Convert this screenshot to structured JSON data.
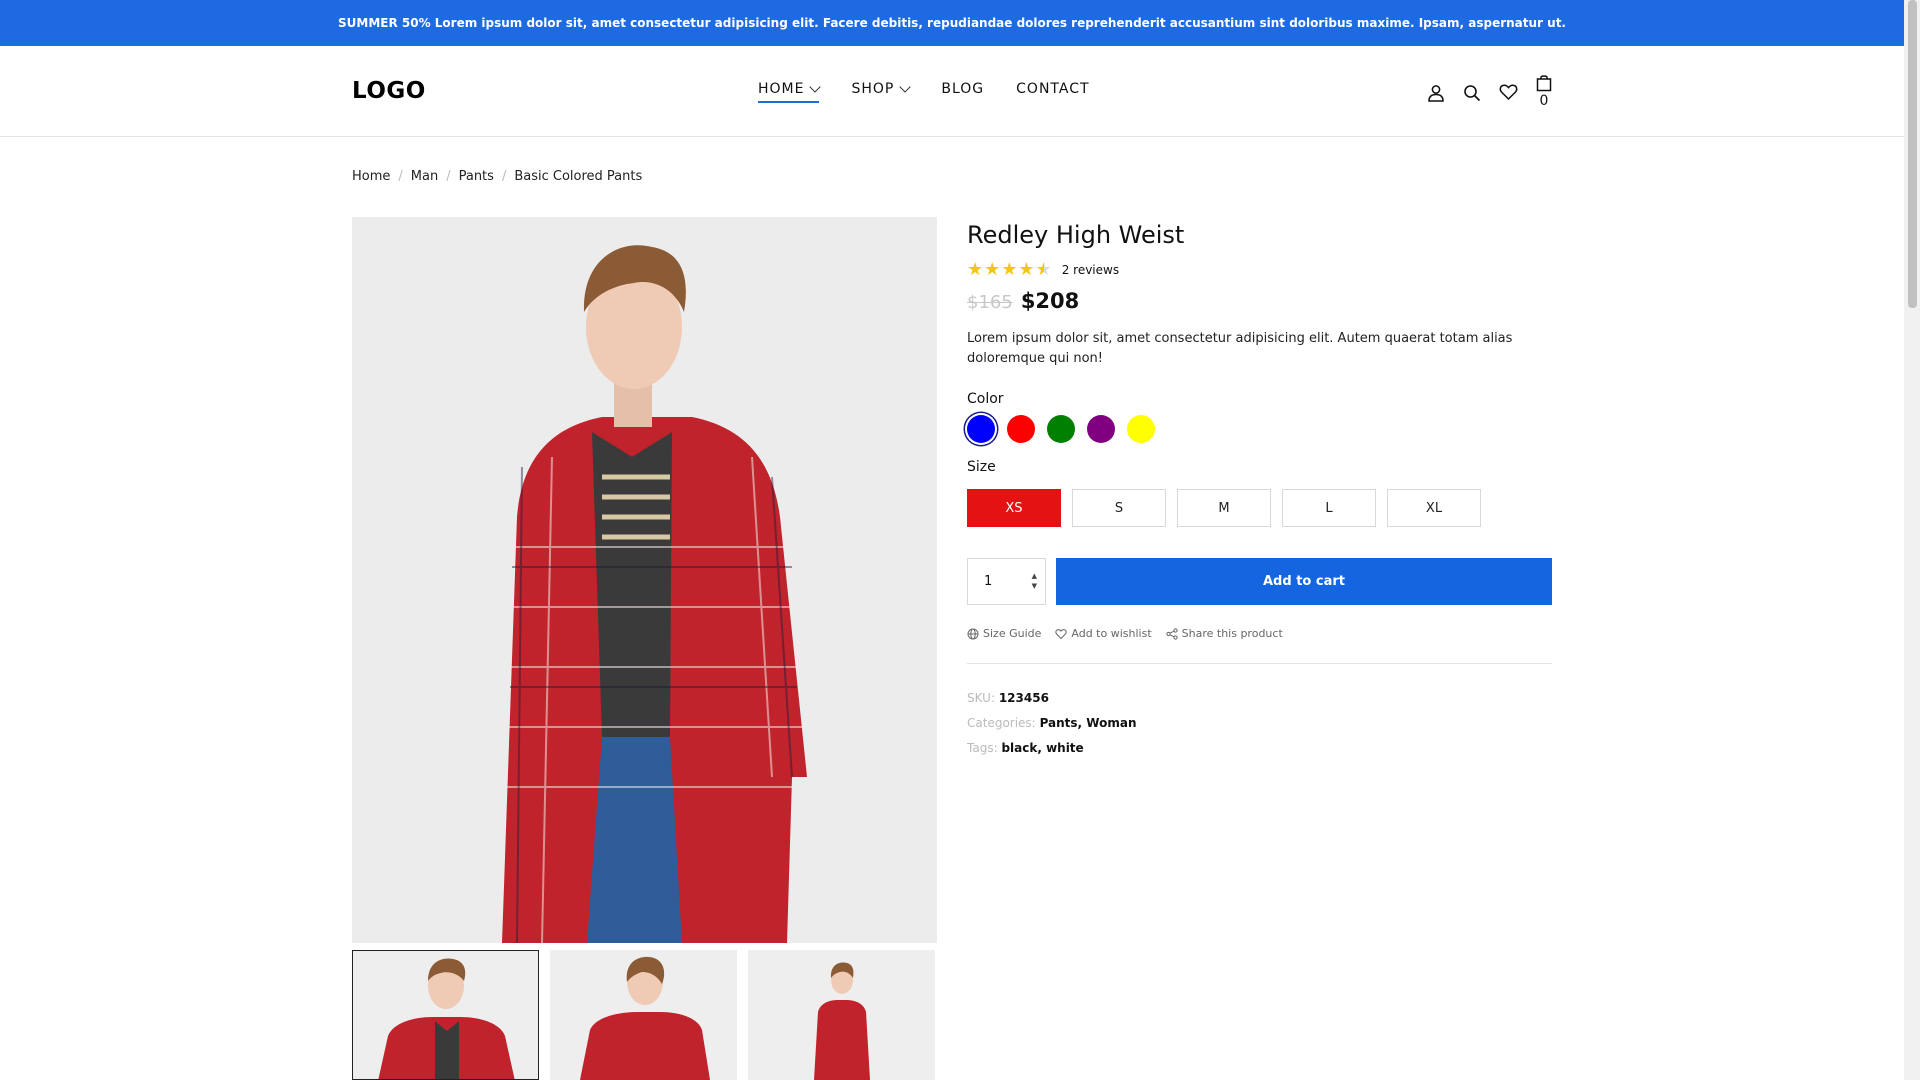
{
  "promo": {
    "text": "SUMMER 50% Lorem ipsum dolor sit, amet consectetur adipisicing elit. Facere debitis, repudiandae dolores reprehenderit accusantium sint doloribus maxime. Ipsam, aspernatur ut."
  },
  "header": {
    "logo": "LOGO",
    "nav": {
      "home": "HOME",
      "shop": "SHOP",
      "blog": "BLOG",
      "contact": "CONTACT"
    },
    "cart_count": "0",
    "icons": [
      "user-icon",
      "search-icon",
      "heart-icon",
      "shopping-bag-icon"
    ]
  },
  "breadcrumb": {
    "home": "Home",
    "man": "Man",
    "pants": "Pants",
    "current": "Basic Colored Pants"
  },
  "product": {
    "title": "Redley High Weist",
    "rating": 4.5,
    "reviews": "2 reviews",
    "old_price": "$165",
    "price": "$208",
    "description": "Lorem ipsum dolor sit, amet consectetur adipisicing elit. Autem quaerat totam alias doloremque qui non!",
    "color_label": "Color",
    "colors": [
      "#0000ff",
      "#ff0000",
      "#008000",
      "#800080",
      "#ffff00"
    ],
    "selected_color": "#0000ff",
    "size_label": "Size",
    "sizes": {
      "xs": "XS",
      "s": "S",
      "m": "M",
      "l": "L",
      "xl": "XL"
    },
    "selected_size": "XS",
    "quantity": "1",
    "add_to_cart": "Add to cart",
    "actions": {
      "size_guide": "Size Guide",
      "wishlist": "Add to wishlist",
      "share": "Share this product"
    },
    "meta": {
      "sku_label": "SKU:",
      "sku": "123456",
      "categories_label": "Categories:",
      "categories": "Pants, Woman",
      "tags_label": "Tags:",
      "tags": "black, white"
    }
  },
  "colors": {
    "accent": "#1e6ae0",
    "sale_size": "#e41212",
    "stars": "#f5c518"
  }
}
